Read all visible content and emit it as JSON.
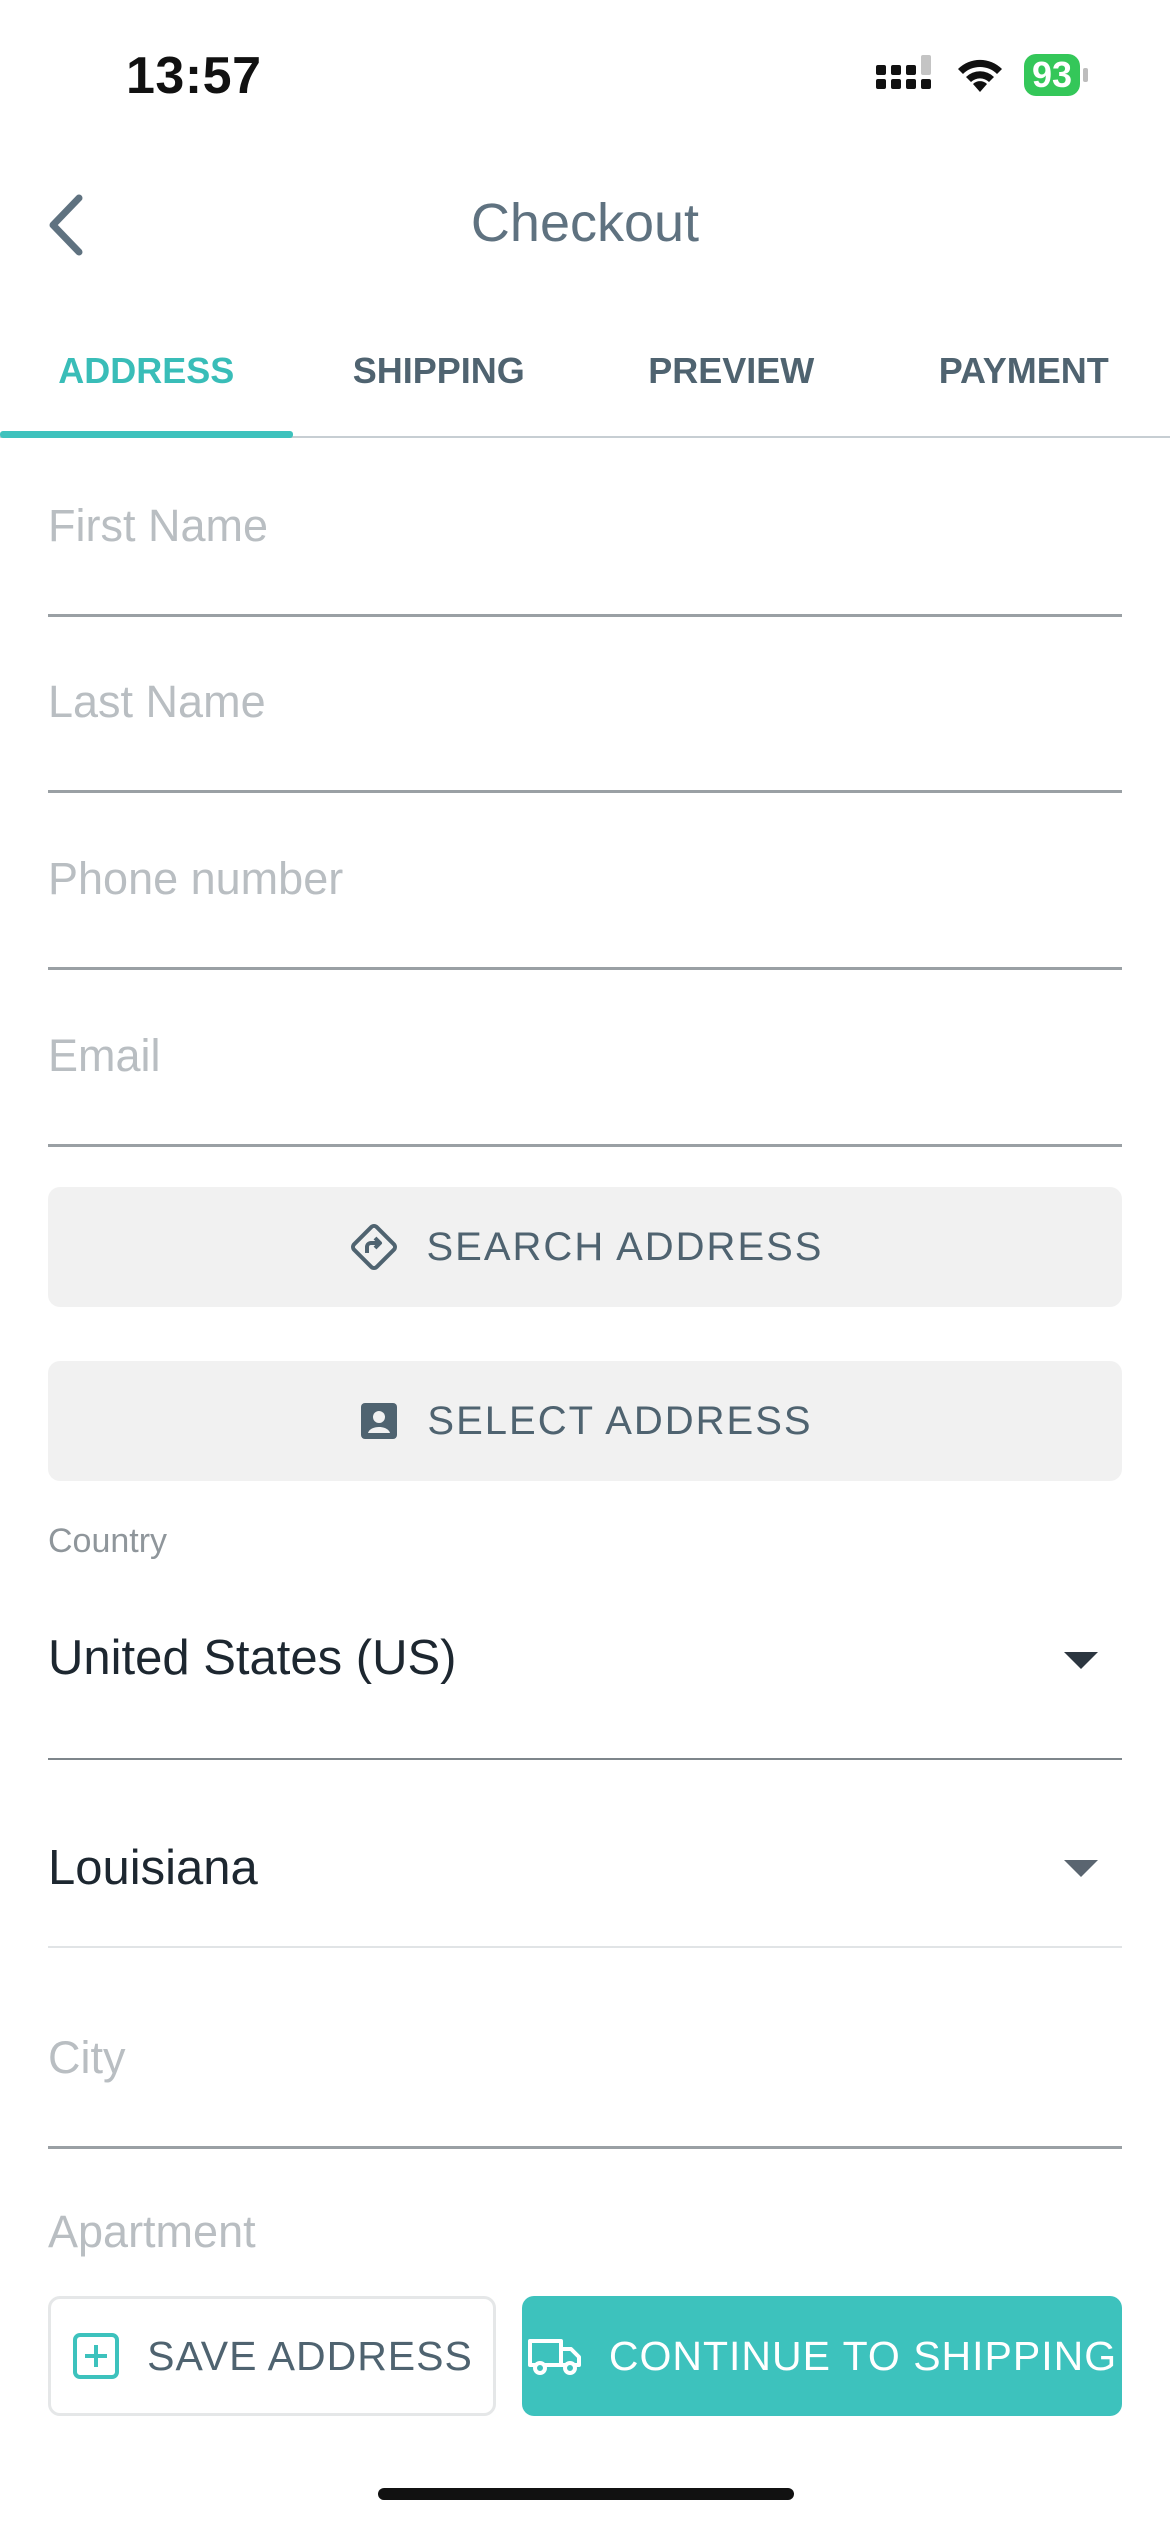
{
  "status_bar": {
    "time": "13:57",
    "battery": "93",
    "icons": [
      "signal-icon",
      "wifi-icon",
      "battery-icon"
    ]
  },
  "header": {
    "title": "Checkout",
    "back_icon": "chevron-left-icon"
  },
  "tabs": [
    {
      "label": "ADDRESS",
      "active": true
    },
    {
      "label": "SHIPPING",
      "active": false
    },
    {
      "label": "PREVIEW",
      "active": false
    },
    {
      "label": "PAYMENT",
      "active": false
    }
  ],
  "form": {
    "first_name": {
      "placeholder": "First Name",
      "value": ""
    },
    "last_name": {
      "placeholder": "Last Name",
      "value": ""
    },
    "phone": {
      "placeholder": "Phone number",
      "value": ""
    },
    "email": {
      "placeholder": "Email",
      "value": ""
    },
    "search_address": {
      "label": "SEARCH ADDRESS",
      "icon": "directions-icon"
    },
    "select_address": {
      "label": "SELECT ADDRESS",
      "icon": "contact-card-icon"
    },
    "country": {
      "label": "Country",
      "value": "United States (US)"
    },
    "state": {
      "value": "Louisiana"
    },
    "city": {
      "placeholder": "City",
      "value": ""
    },
    "apartment": {
      "placeholder": "Apartment",
      "value": ""
    }
  },
  "actions": {
    "save_label": "SAVE ADDRESS",
    "save_icon": "add-box-icon",
    "continue_label": "CONTINUE TO SHIPPING",
    "continue_icon": "truck-icon"
  },
  "colors": {
    "accent": "#3dc2bd",
    "text_primary": "#1d2730",
    "text_secondary": "#4f6370",
    "placeholder": "#b9bec2",
    "battery_green": "#34c759"
  }
}
